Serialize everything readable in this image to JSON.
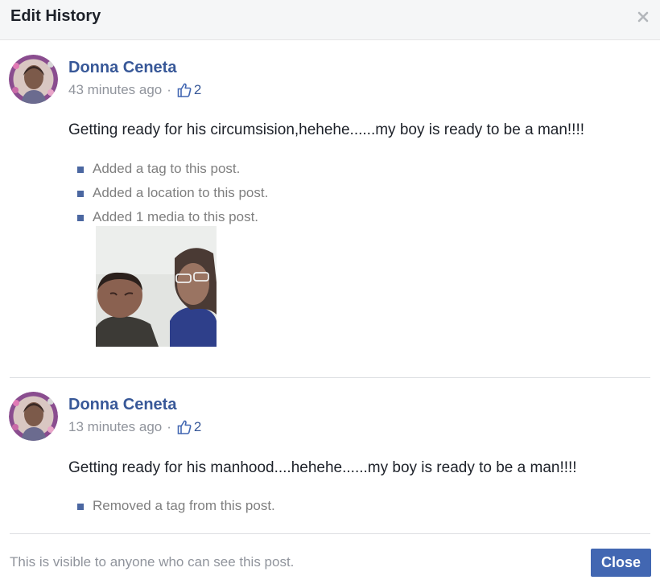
{
  "dialog": {
    "title": "Edit History",
    "close_icon": "close-icon"
  },
  "entries": [
    {
      "author": "Donna Ceneta",
      "time": "43 minutes ago",
      "separator": "·",
      "like_count": "2",
      "text": "Getting ready for his circumsision,hehehe......my boy is ready to be a man!!!!",
      "changes": [
        "Added a tag to this post.",
        "Added a location to this post.",
        "Added 1 media to this post."
      ]
    },
    {
      "author": "Donna Ceneta",
      "time": "13 minutes ago",
      "separator": "·",
      "like_count": "2",
      "text": "Getting ready for his manhood....hehehe......my boy is ready to be a man!!!!",
      "changes": [
        "Removed a tag from this post."
      ]
    }
  ],
  "footer": {
    "note": "This is visible to anyone who can see this post.",
    "close_label": "Close"
  },
  "colors": {
    "accent": "#4267b2",
    "link": "#385898",
    "muted": "#90949c"
  }
}
